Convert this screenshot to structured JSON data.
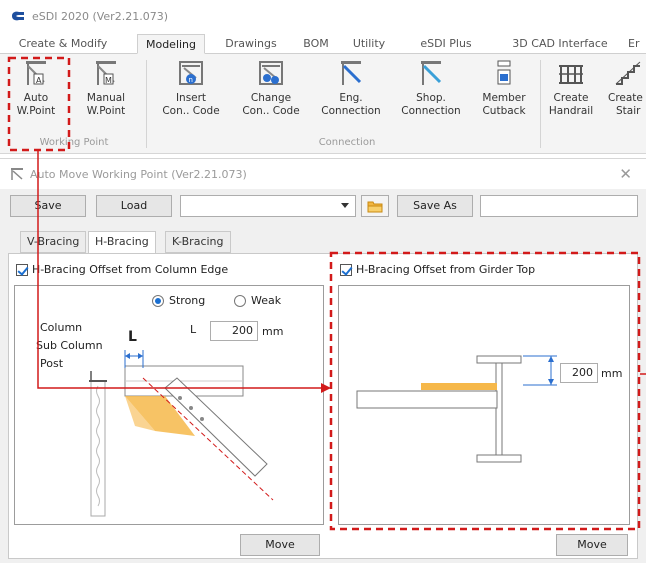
{
  "app": {
    "title": "eSDI 2020 (Ver2.21.073)"
  },
  "ribbon": {
    "tabs": [
      {
        "label": "Create & Modify"
      },
      {
        "label": "Modeling",
        "active": true
      },
      {
        "label": "Drawings"
      },
      {
        "label": "BOM"
      },
      {
        "label": "Utility"
      },
      {
        "label": "eSDI Plus"
      },
      {
        "label": "3D CAD Interface"
      },
      {
        "label": "Er"
      }
    ],
    "groups": {
      "working_point": {
        "label": "Working Point",
        "auto": {
          "line1": "Auto",
          "line2": "W.Point"
        },
        "manual": {
          "line1": "Manual",
          "line2": "W.Point"
        }
      },
      "connection": {
        "label": "Connection",
        "insert": {
          "line1": "Insert",
          "line2": "Con.. Code"
        },
        "change": {
          "line1": "Change",
          "line2": "Con.. Code"
        },
        "eng": {
          "line1": "Eng.",
          "line2": "Connection"
        },
        "shop": {
          "line1": "Shop.",
          "line2": "Connection"
        },
        "cutback": {
          "line1": "Member",
          "line2": "Cutback"
        }
      },
      "extra": {
        "handrail": {
          "line1": "Create",
          "line2": "Handrail"
        },
        "stair": {
          "line1": "Create",
          "line2": "Stair"
        }
      }
    }
  },
  "dialog": {
    "title": "Auto Move Working Point (Ver2.21.073)",
    "toolbar": {
      "save": "Save",
      "load": "Load",
      "save_as": "Save As"
    },
    "tabs": [
      {
        "label": "V-Bracing"
      },
      {
        "label": "H-Bracing",
        "active": true
      },
      {
        "label": "K-Bracing"
      }
    ],
    "left": {
      "checkbox_label": "H-Bracing Offset from Column Edge",
      "checked": true,
      "radio_strong": "Strong",
      "radio_weak": "Weak",
      "selected": "Strong",
      "member_labels": [
        "Column",
        "Sub Column",
        "Post"
      ],
      "l_label": "L",
      "l_value": "200",
      "unit": "mm",
      "dim_label": "L",
      "move": "Move"
    },
    "right": {
      "checkbox_label": "H-Bracing Offset from Girder Top",
      "checked": true,
      "value": "200",
      "unit": "mm",
      "move": "Move"
    }
  },
  "colors": {
    "highlight": "#d21a1a",
    "accent": "#1a6fd1",
    "brace_fill": "#f6b84a"
  }
}
